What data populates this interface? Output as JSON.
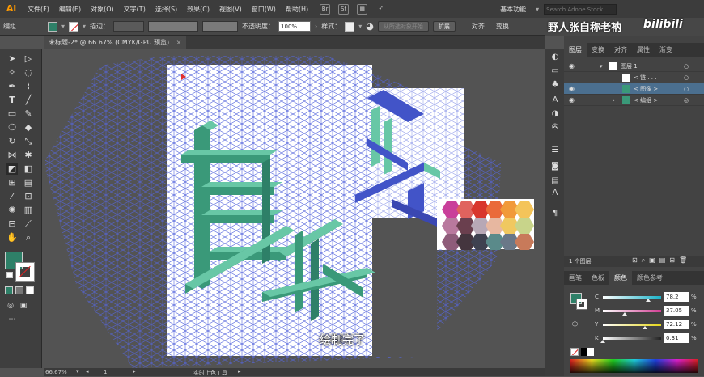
{
  "app": {
    "logo": "Ai"
  },
  "menu": [
    "文件(F)",
    "编辑(E)",
    "对象(O)",
    "文字(T)",
    "选择(S)",
    "效果(C)",
    "视图(V)",
    "窗口(W)",
    "帮助(H)"
  ],
  "menubar_icons": {
    "bridge": "Br",
    "stock": "St"
  },
  "workspace": {
    "label": "基本功能",
    "search_placeholder": "Search Adobe Stock"
  },
  "control": {
    "selection_label": "编组",
    "stroke_label": "描边：",
    "opacity_label": "不透明度：",
    "opacity_value": "100%",
    "style_label": "样式：",
    "live_paint_button": "从所选对象开始",
    "expand_button": "扩展",
    "align_label": "对齐",
    "transform_label": "变换"
  },
  "watermark": {
    "author": "野人张自称老衲",
    "site": "bilibili"
  },
  "document": {
    "tab_title": "未标题-2* @ 66.67% (CMYK/GPU 预览)",
    "close": "×"
  },
  "status": {
    "zoom": "66.67%",
    "artboard": "1",
    "tool_name": "实时上色工具"
  },
  "subtitle": "绘制完了",
  "panels": {
    "tabs": [
      "图层",
      "变换",
      "对齐",
      "属性",
      "渐变"
    ],
    "layers": [
      {
        "name": "图层 1",
        "selected": false
      },
      {
        "name": "< 链 . . .",
        "selected": false
      },
      {
        "name": "< 图像 >",
        "selected": true
      },
      {
        "name": "< 编组 >",
        "selected": false
      }
    ],
    "layer_count": "1 个图层",
    "color_tabs": [
      "画笔",
      "色板",
      "颜色",
      "颜色参考"
    ],
    "cmyk": [
      {
        "label": "C",
        "value": "78.2",
        "pct": "%",
        "color": "#1bb3c9",
        "level": 0.782
      },
      {
        "label": "M",
        "value": "37.05",
        "pct": "%",
        "color": "#d13e93",
        "level": 0.3705
      },
      {
        "label": "Y",
        "value": "72.12",
        "pct": "%",
        "color": "#e6d61a",
        "level": 0.7212
      },
      {
        "label": "K",
        "value": "0.31",
        "pct": "%",
        "color": "#222222",
        "level": 0.0031
      }
    ]
  },
  "colors": {
    "fill": "#2e8068",
    "cube_light": "#68c7a6",
    "cube_dark": "#3a9979",
    "grid": "#4656d8",
    "blue_cube": "#4254c8"
  }
}
